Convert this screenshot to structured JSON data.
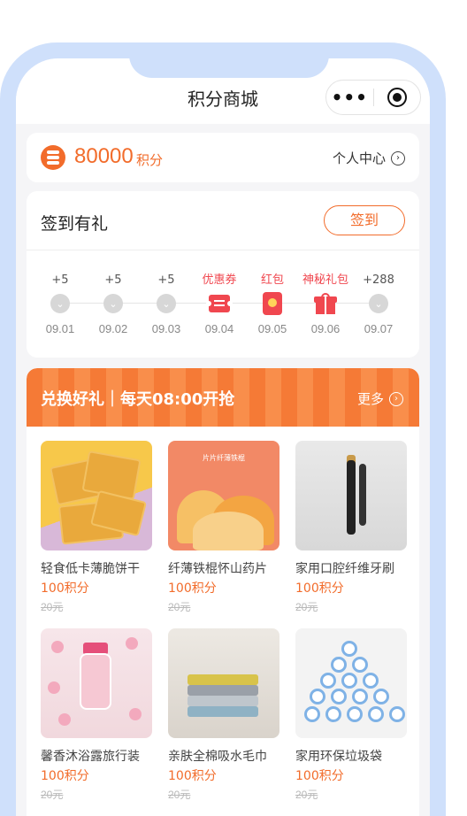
{
  "nav": {
    "title": "积分商城",
    "more_glyph": "•••"
  },
  "points": {
    "value": "80000",
    "unit": "积分",
    "center_label": "个人中心"
  },
  "signin": {
    "title": "签到有礼",
    "button": "签到",
    "days": [
      {
        "reward": "+5",
        "date": "09.01",
        "icon": "chevron-down-icon",
        "highlight": false
      },
      {
        "reward": "+5",
        "date": "09.02",
        "icon": "chevron-down-icon",
        "highlight": false
      },
      {
        "reward": "+5",
        "date": "09.03",
        "icon": "chevron-down-icon",
        "highlight": false
      },
      {
        "reward": "优惠券",
        "date": "09.04",
        "icon": "coupon-icon",
        "highlight": true
      },
      {
        "reward": "红包",
        "date": "09.05",
        "icon": "red-packet-icon",
        "highlight": true
      },
      {
        "reward": "神秘礼包",
        "date": "09.06",
        "icon": "gift-icon",
        "highlight": true
      },
      {
        "reward": "+288",
        "date": "09.07",
        "icon": "chevron-down-icon",
        "highlight": false
      }
    ]
  },
  "exchange": {
    "title": "兑换好礼｜每天08:00开抢",
    "more": "更多",
    "products": [
      {
        "name": "轻食低卡薄脆饼干",
        "points": "100积分",
        "original": "20元",
        "art": "cracker"
      },
      {
        "name": "纤薄铁棍怀山药片",
        "points": "100积分",
        "original": "20元",
        "art": "yam",
        "image_label": "片片纤薄铁棍"
      },
      {
        "name": "家用口腔纤维牙刷",
        "points": "100积分",
        "original": "20元",
        "art": "brush"
      },
      {
        "name": "馨香沐浴露旅行装",
        "points": "100积分",
        "original": "20元",
        "art": "shower"
      },
      {
        "name": "亲肤全棉吸水毛巾",
        "points": "100积分",
        "original": "20元",
        "art": "towel"
      },
      {
        "name": "家用环保垃圾袋",
        "points": "100积分",
        "original": "20元",
        "art": "bags"
      }
    ]
  },
  "colors": {
    "accent": "#f26c2b",
    "highlight": "#f0474f",
    "frame": "#cfe0fb"
  }
}
